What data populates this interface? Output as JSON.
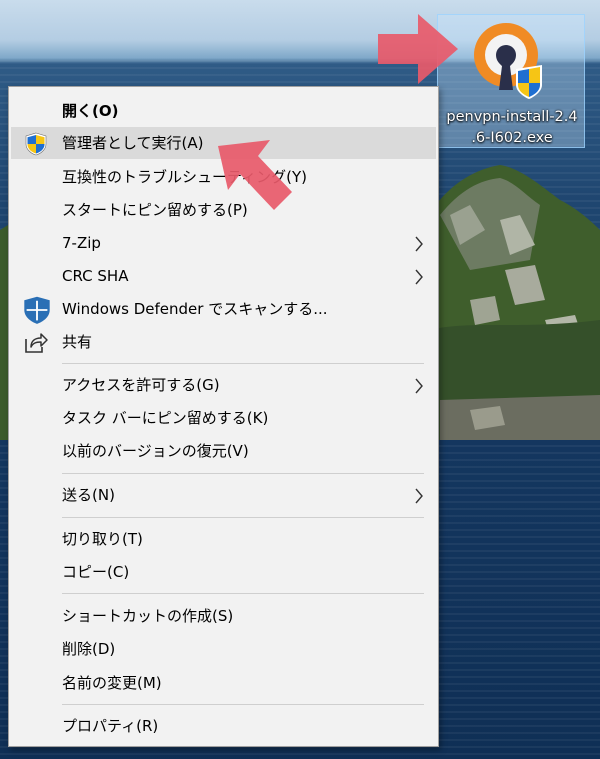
{
  "file": {
    "name_line1": "penvpn-install-2.4",
    "name_line2": ".6-I602.exe",
    "icon": "openvpn-uac-icon"
  },
  "annotation_color": "#e85a6a",
  "menu": {
    "items": [
      {
        "label": "開く(O)",
        "icon": ""
      },
      {
        "label": "管理者として実行(A)",
        "icon": "uac-shield-icon"
      },
      {
        "label": "互換性のトラブルシューティング(Y)",
        "icon": ""
      },
      {
        "label": "スタートにピン留めする(P)",
        "icon": ""
      },
      {
        "label": "7-Zip",
        "icon": "",
        "submenu": true
      },
      {
        "label": "CRC SHA",
        "icon": "",
        "submenu": true
      },
      {
        "label": "Windows Defender でスキャンする...",
        "icon": "defender-shield-icon"
      },
      {
        "label": "共有",
        "icon": "share-icon"
      },
      {
        "label": "アクセスを許可する(G)",
        "icon": "",
        "submenu": true
      },
      {
        "label": "タスク バーにピン留めする(K)",
        "icon": ""
      },
      {
        "label": "以前のバージョンの復元(V)",
        "icon": ""
      },
      {
        "label": "送る(N)",
        "icon": "",
        "submenu": true
      },
      {
        "label": "切り取り(T)",
        "icon": ""
      },
      {
        "label": "コピー(C)",
        "icon": ""
      },
      {
        "label": "ショートカットの作成(S)",
        "icon": ""
      },
      {
        "label": "削除(D)",
        "icon": ""
      },
      {
        "label": "名前の変更(M)",
        "icon": ""
      },
      {
        "label": "プロパティ(R)",
        "icon": ""
      }
    ],
    "highlighted_item": "管理者として実行(A)"
  }
}
